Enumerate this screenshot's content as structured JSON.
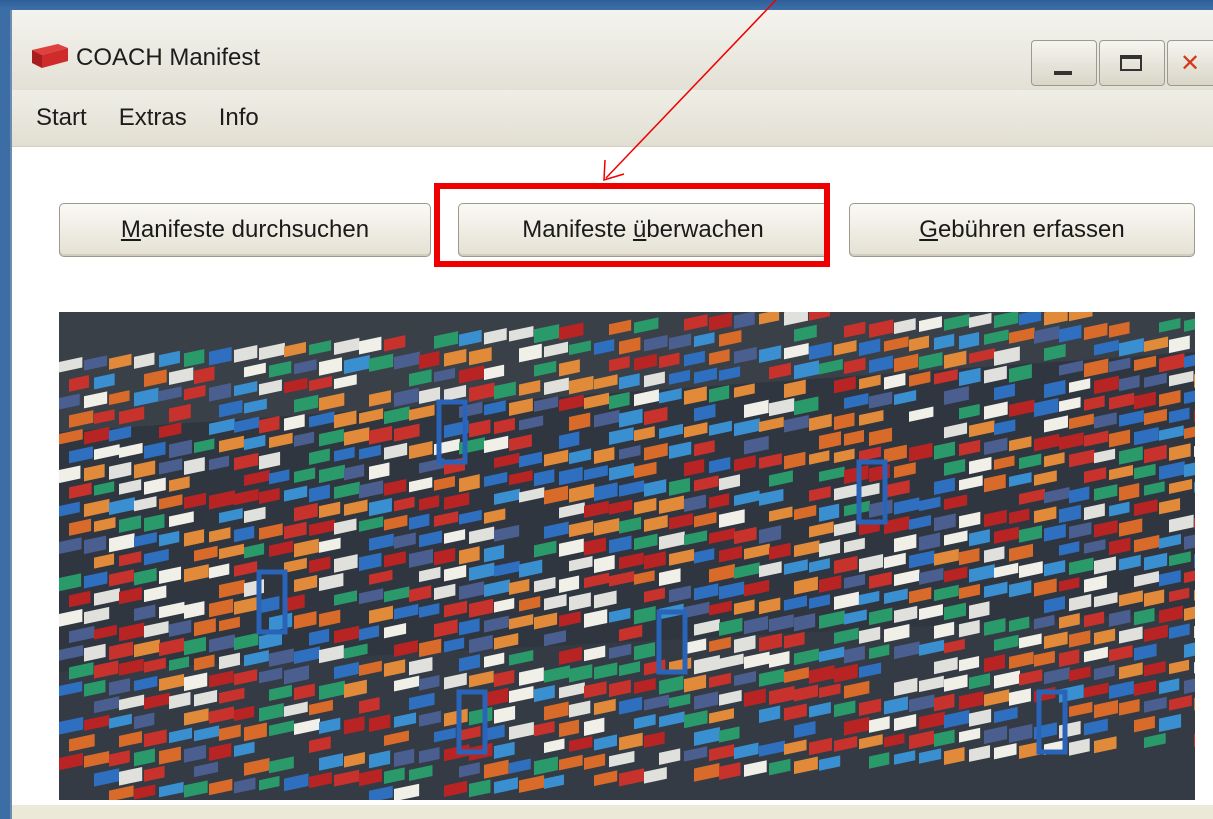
{
  "window": {
    "title": "COACH Manifest"
  },
  "menu": {
    "items": [
      "Start",
      "Extras",
      "Info"
    ]
  },
  "buttons": {
    "search": {
      "pre": "",
      "acc": "M",
      "post": "anifeste durchsuchen"
    },
    "monitor": {
      "pre": "Manifeste ",
      "acc": "ü",
      "post": "berwachen"
    },
    "fees": {
      "pre": "",
      "acc": "G",
      "post": "ebühren erfassen"
    }
  },
  "image": {
    "subject": "container-terminal-aerial-photo"
  },
  "colors": {
    "highlight": "#ee0000",
    "arrow": "#ee0000",
    "window_bg": "#ece9d8",
    "desktop": "#3c6ea5"
  }
}
